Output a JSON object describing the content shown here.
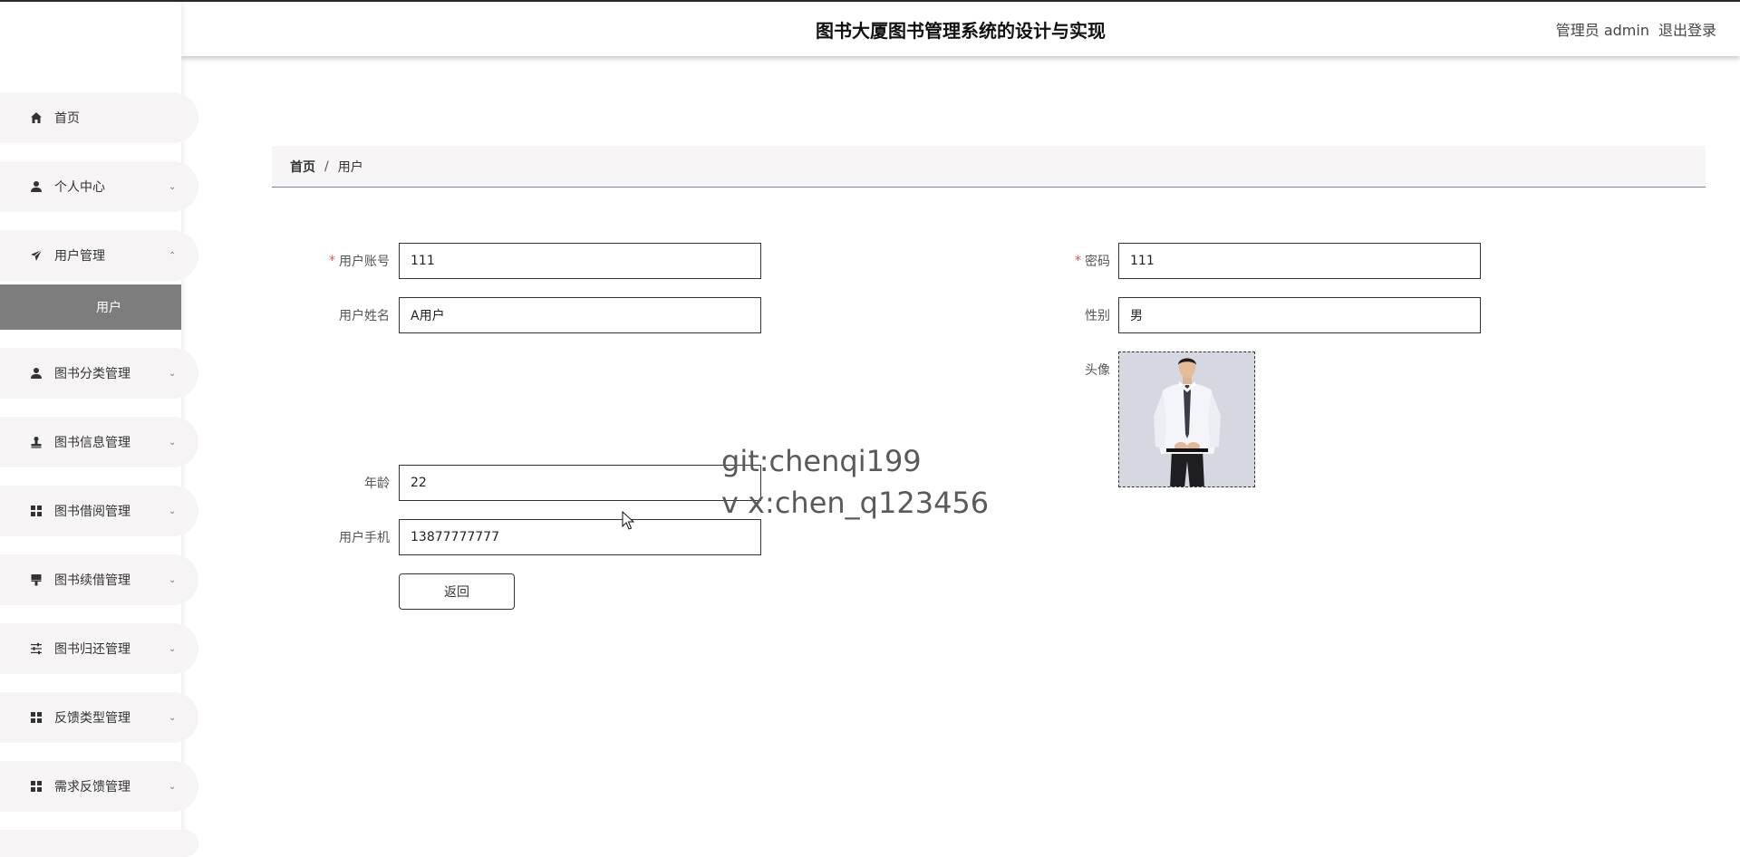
{
  "header": {
    "title": "图书大厦图书管理系统的设计与实现",
    "user_label": "管理员 admin",
    "logout_label": "退出登录"
  },
  "sidebar": {
    "items": [
      {
        "label": "首页",
        "icon": "home-icon"
      },
      {
        "label": "个人中心",
        "icon": "person-icon"
      },
      {
        "label": "用户管理",
        "icon": "send-icon"
      },
      {
        "label": "图书分类管理",
        "icon": "person-icon"
      },
      {
        "label": "图书信息管理",
        "icon": "stamp-icon"
      },
      {
        "label": "图书借阅管理",
        "icon": "grid-icon"
      },
      {
        "label": "图书续借管理",
        "icon": "brush-icon"
      },
      {
        "label": "图书归还管理",
        "icon": "sliders-icon"
      },
      {
        "label": "反馈类型管理",
        "icon": "grid-icon"
      },
      {
        "label": "需求反馈管理",
        "icon": "grid-icon"
      }
    ],
    "submenu_active": "用户"
  },
  "breadcrumb": {
    "home": "首页",
    "separator": "/",
    "current": "用户"
  },
  "form": {
    "account_label": "用户账号",
    "account_value": "111",
    "password_label": "密码",
    "password_value": "111",
    "name_label": "用户姓名",
    "name_value": "A用户",
    "gender_label": "性别",
    "gender_value": "男",
    "avatar_label": "头像",
    "age_label": "年龄",
    "age_value": "22",
    "phone_label": "用户手机",
    "phone_value": "13877777777",
    "required_mark": "*",
    "back_label": "返回"
  },
  "watermark": {
    "line1": "git:chenqi199",
    "line2": "v x:chen_q123456"
  },
  "colors": {
    "accent_submenu": "#7d7d7d",
    "required": "#e05050",
    "menu_bg": "#f6f4f4"
  }
}
